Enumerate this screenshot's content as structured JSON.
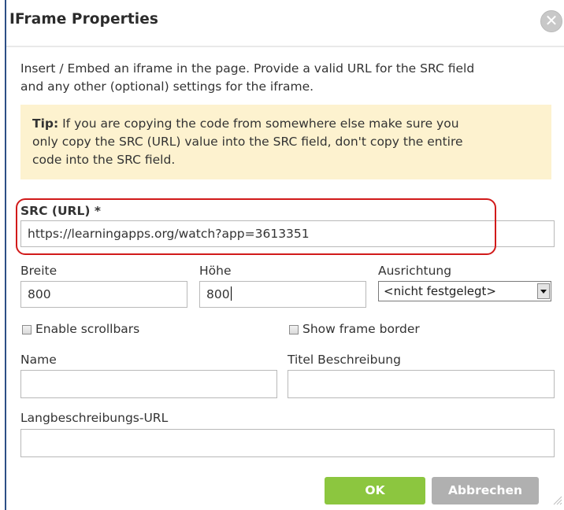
{
  "dialog": {
    "title": "IFrame Properties",
    "close_symbol": "✕",
    "intro_line1": "Insert / Embed an iframe in the page. Provide a valid URL for the SRC field",
    "intro_line2": "and any other (optional) settings for the iframe.",
    "tip_label": "Tip:",
    "tip_line1": " If you are copying the code from somewhere else make sure you",
    "tip_line2": "only copy the SRC (URL) value into the SRC field, don't copy the entire",
    "tip_line3": "code into the SRC field."
  },
  "form": {
    "src_label": "SRC (URL) *",
    "src_value": "https://learningapps.org/watch?app=3613351",
    "width_label": "Breite",
    "width_value": "800",
    "height_label": "Höhe",
    "height_value": "800",
    "align_label": "Ausrichtung",
    "align_value": "<nicht festgelegt>",
    "scrollbars_label": "Enable scrollbars",
    "frameborder_label": "Show frame border",
    "name_label": "Name",
    "name_value": "",
    "title_label": "Titel Beschreibung",
    "title_value": "",
    "longdesc_label": "Langbeschreibungs-URL",
    "longdesc_value": ""
  },
  "buttons": {
    "ok": "OK",
    "cancel": "Abbrechen"
  },
  "colors": {
    "ok_button": "#8cc63f",
    "cancel_button": "#b0b0b0",
    "tip_background": "#fdf2cf",
    "highlight": "#d11a1a"
  }
}
